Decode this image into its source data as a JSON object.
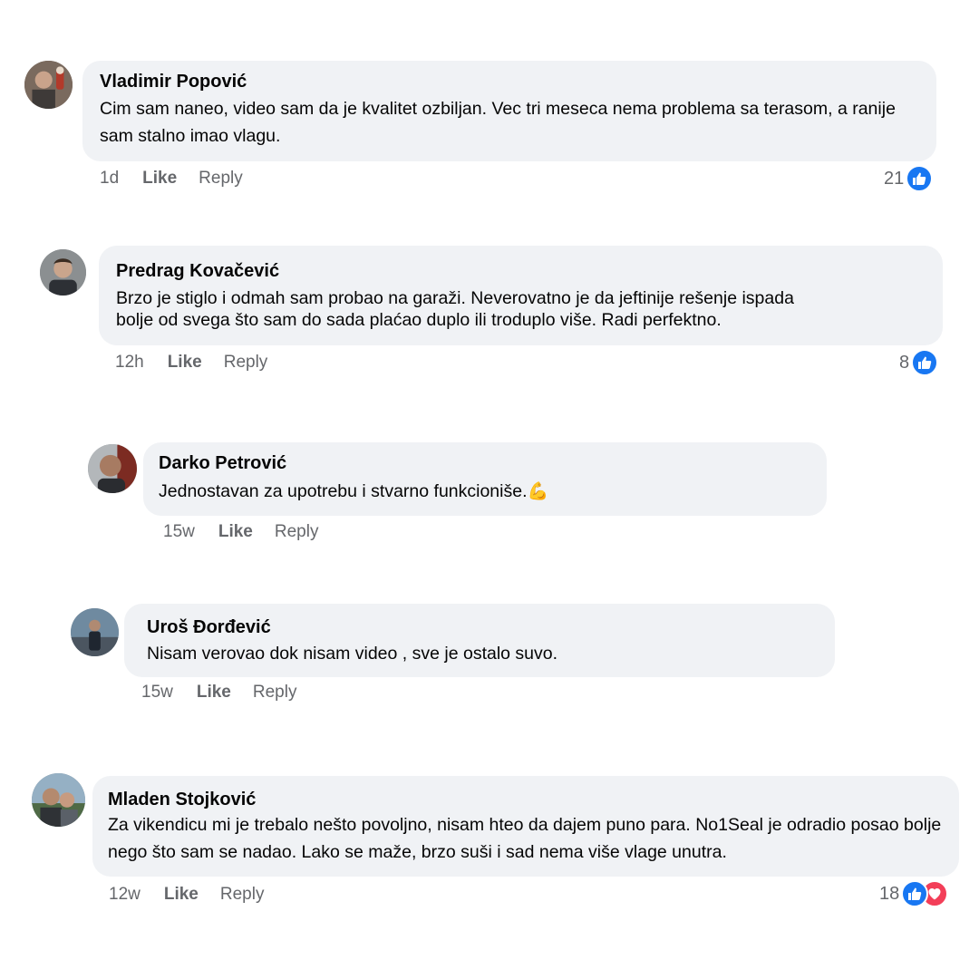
{
  "comments": [
    {
      "author": "Vladimir Popović",
      "text": "Cim sam naneo, video sam da je kvalitet ozbiljan. Vec tri meseca nema problema sa terasom, a ranije sam stalno imao vlagu.",
      "time": "1d",
      "like_label": "Like",
      "reply_label": "Reply",
      "reaction_count": "21",
      "reactions": [
        "like-icon"
      ]
    },
    {
      "author": "Predrag Kovačević",
      "text_lines": [
        "Brzo je stiglo i odmah sam probao na garaži. Neverovatno je da jeftinije rešenje ispada",
        "bolje od svega što sam do sada plaćao duplo ili troduplo više. Radi perfektno."
      ],
      "time": "12h",
      "like_label": "Like",
      "reply_label": "Reply",
      "reaction_count": "8",
      "reactions": [
        "like-icon"
      ]
    },
    {
      "author": "Darko Petrović",
      "text": "Jednostavan za upotrebu i stvarno funkcioniše.",
      "emoji": "💪",
      "time": "15w",
      "like_label": "Like",
      "reply_label": "Reply"
    },
    {
      "author": "Uroš Đorđević",
      "text": "Nisam verovao dok nisam video , sve je ostalo suvo.",
      "time": "15w",
      "like_label": "Like",
      "reply_label": "Reply"
    },
    {
      "author": "Mladen Stojković",
      "text": "Za vikendicu mi je trebalo nešto povoljno, nisam hteo da dajem puno para. No1Seal je odradio posao bolje nego što sam se nadao. Lako se maže, brzo suši i sad nema više vlage unutra.",
      "time": "12w",
      "like_label": "Like",
      "reply_label": "Reply",
      "reaction_count": "18",
      "reactions": [
        "like-icon",
        "love-icon"
      ]
    }
  ],
  "colors": {
    "bubble": "#f0f2f5",
    "meta_text": "#65676b",
    "like_blue": "#1877f2",
    "love_red": "#f33e58"
  }
}
